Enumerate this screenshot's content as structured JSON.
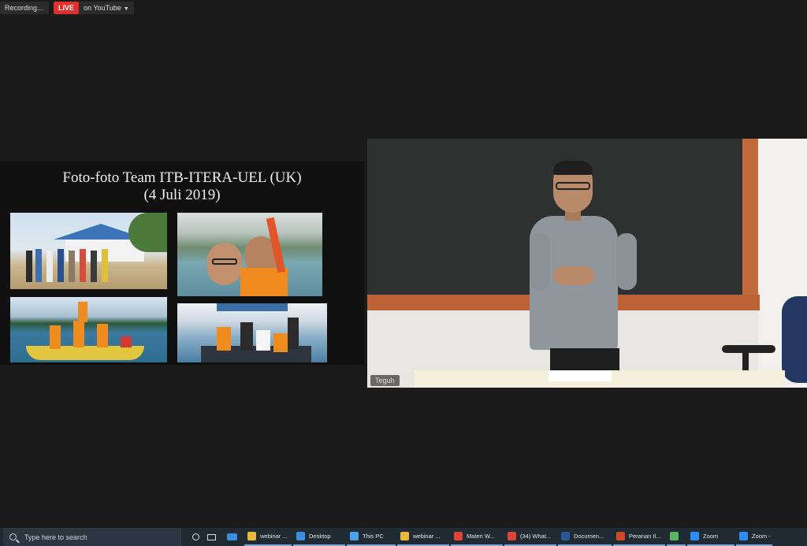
{
  "recording": {
    "status": "Recording...",
    "live_badge": "LIVE",
    "live_target": "on YouTube"
  },
  "slide": {
    "title_line1": "Foto-foto Team ITB-ITERA-UEL (UK)",
    "title_line2": "(4 Juli 2019)"
  },
  "webcam": {
    "participant_name": "Teguh"
  },
  "taskbar": {
    "search_placeholder": "Type here to search",
    "items": [
      {
        "label": "webinar ...",
        "icon": "folder-icon",
        "color": "#e8b93a",
        "width": 60
      },
      {
        "label": "Desktop",
        "icon": "desktop-icon",
        "color": "#3a8de0",
        "width": 66
      },
      {
        "label": "This PC",
        "icon": "pc-icon",
        "color": "#4aa3e8",
        "width": 62
      },
      {
        "label": "webinar ...",
        "icon": "folder-icon",
        "color": "#e8b93a",
        "width": 66
      },
      {
        "label": "Materi W...",
        "icon": "chrome-icon",
        "color": "#db4437",
        "width": 66
      },
      {
        "label": "(34) What...",
        "icon": "chrome-icon",
        "color": "#db4437",
        "width": 66
      },
      {
        "label": "Documen...",
        "icon": "word-icon",
        "color": "#2b5797",
        "width": 68
      },
      {
        "label": "Peranan Il...",
        "icon": "powerpoint-icon",
        "color": "#d24726",
        "width": 66
      },
      {
        "label": "",
        "icon": "notepad-icon",
        "color": "#57b65f",
        "width": 24
      },
      {
        "label": "Zoom",
        "icon": "zoom-icon",
        "color": "#2d8cff",
        "width": 60
      },
      {
        "label": "Zoom -",
        "icon": "zoom-icon",
        "color": "#2d8cff",
        "width": 46
      }
    ]
  }
}
